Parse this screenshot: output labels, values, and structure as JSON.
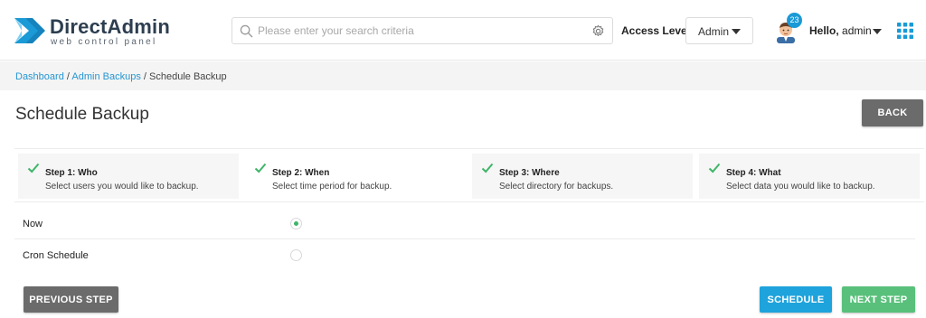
{
  "header": {
    "brand": {
      "name": "DirectAdmin",
      "tagline": "web control panel"
    },
    "search": {
      "placeholder": "Please enter your search criteria"
    },
    "access_level": {
      "label": "Access Level",
      "value": "Admin"
    },
    "user": {
      "greeting": "Hello,",
      "name": "admin",
      "notification_count": "23"
    },
    "icons": {
      "search": "search-icon",
      "settings": "gear-icon",
      "apps": "apps-grid-icon",
      "avatar": "user-avatar"
    }
  },
  "breadcrumb": {
    "items": [
      {
        "label": "Dashboard",
        "link": true
      },
      {
        "label": "Admin Backups",
        "link": true
      },
      {
        "label": "Schedule Backup",
        "link": false
      }
    ],
    "separator": "/"
  },
  "page": {
    "title": "Schedule Backup",
    "back_label": "BACK"
  },
  "steps": [
    {
      "title": "Step 1: Who",
      "description": "Select users you would like to backup.",
      "completed": true
    },
    {
      "title": "Step 2: When",
      "description": "Select time period for backup.",
      "completed": true,
      "active": true
    },
    {
      "title": "Step 3: Where",
      "description": "Select directory for backups.",
      "completed": true
    },
    {
      "title": "Step 4: What",
      "description": "Select data you would like to backup.",
      "completed": true
    }
  ],
  "options": [
    {
      "label": "Now",
      "selected": true
    },
    {
      "label": "Cron Schedule",
      "selected": false
    }
  ],
  "footer": {
    "previous_label": "PREVIOUS STEP",
    "schedule_label": "SCHEDULE",
    "next_label": "NEXT STEP"
  },
  "colors": {
    "brand_blue": "#1a9ad6",
    "link_blue": "#2596d1",
    "check_green": "#3fb56a",
    "next_green": "#59c07b",
    "schedule_blue": "#1ea3dc",
    "button_gray": "#6b6b6b"
  }
}
